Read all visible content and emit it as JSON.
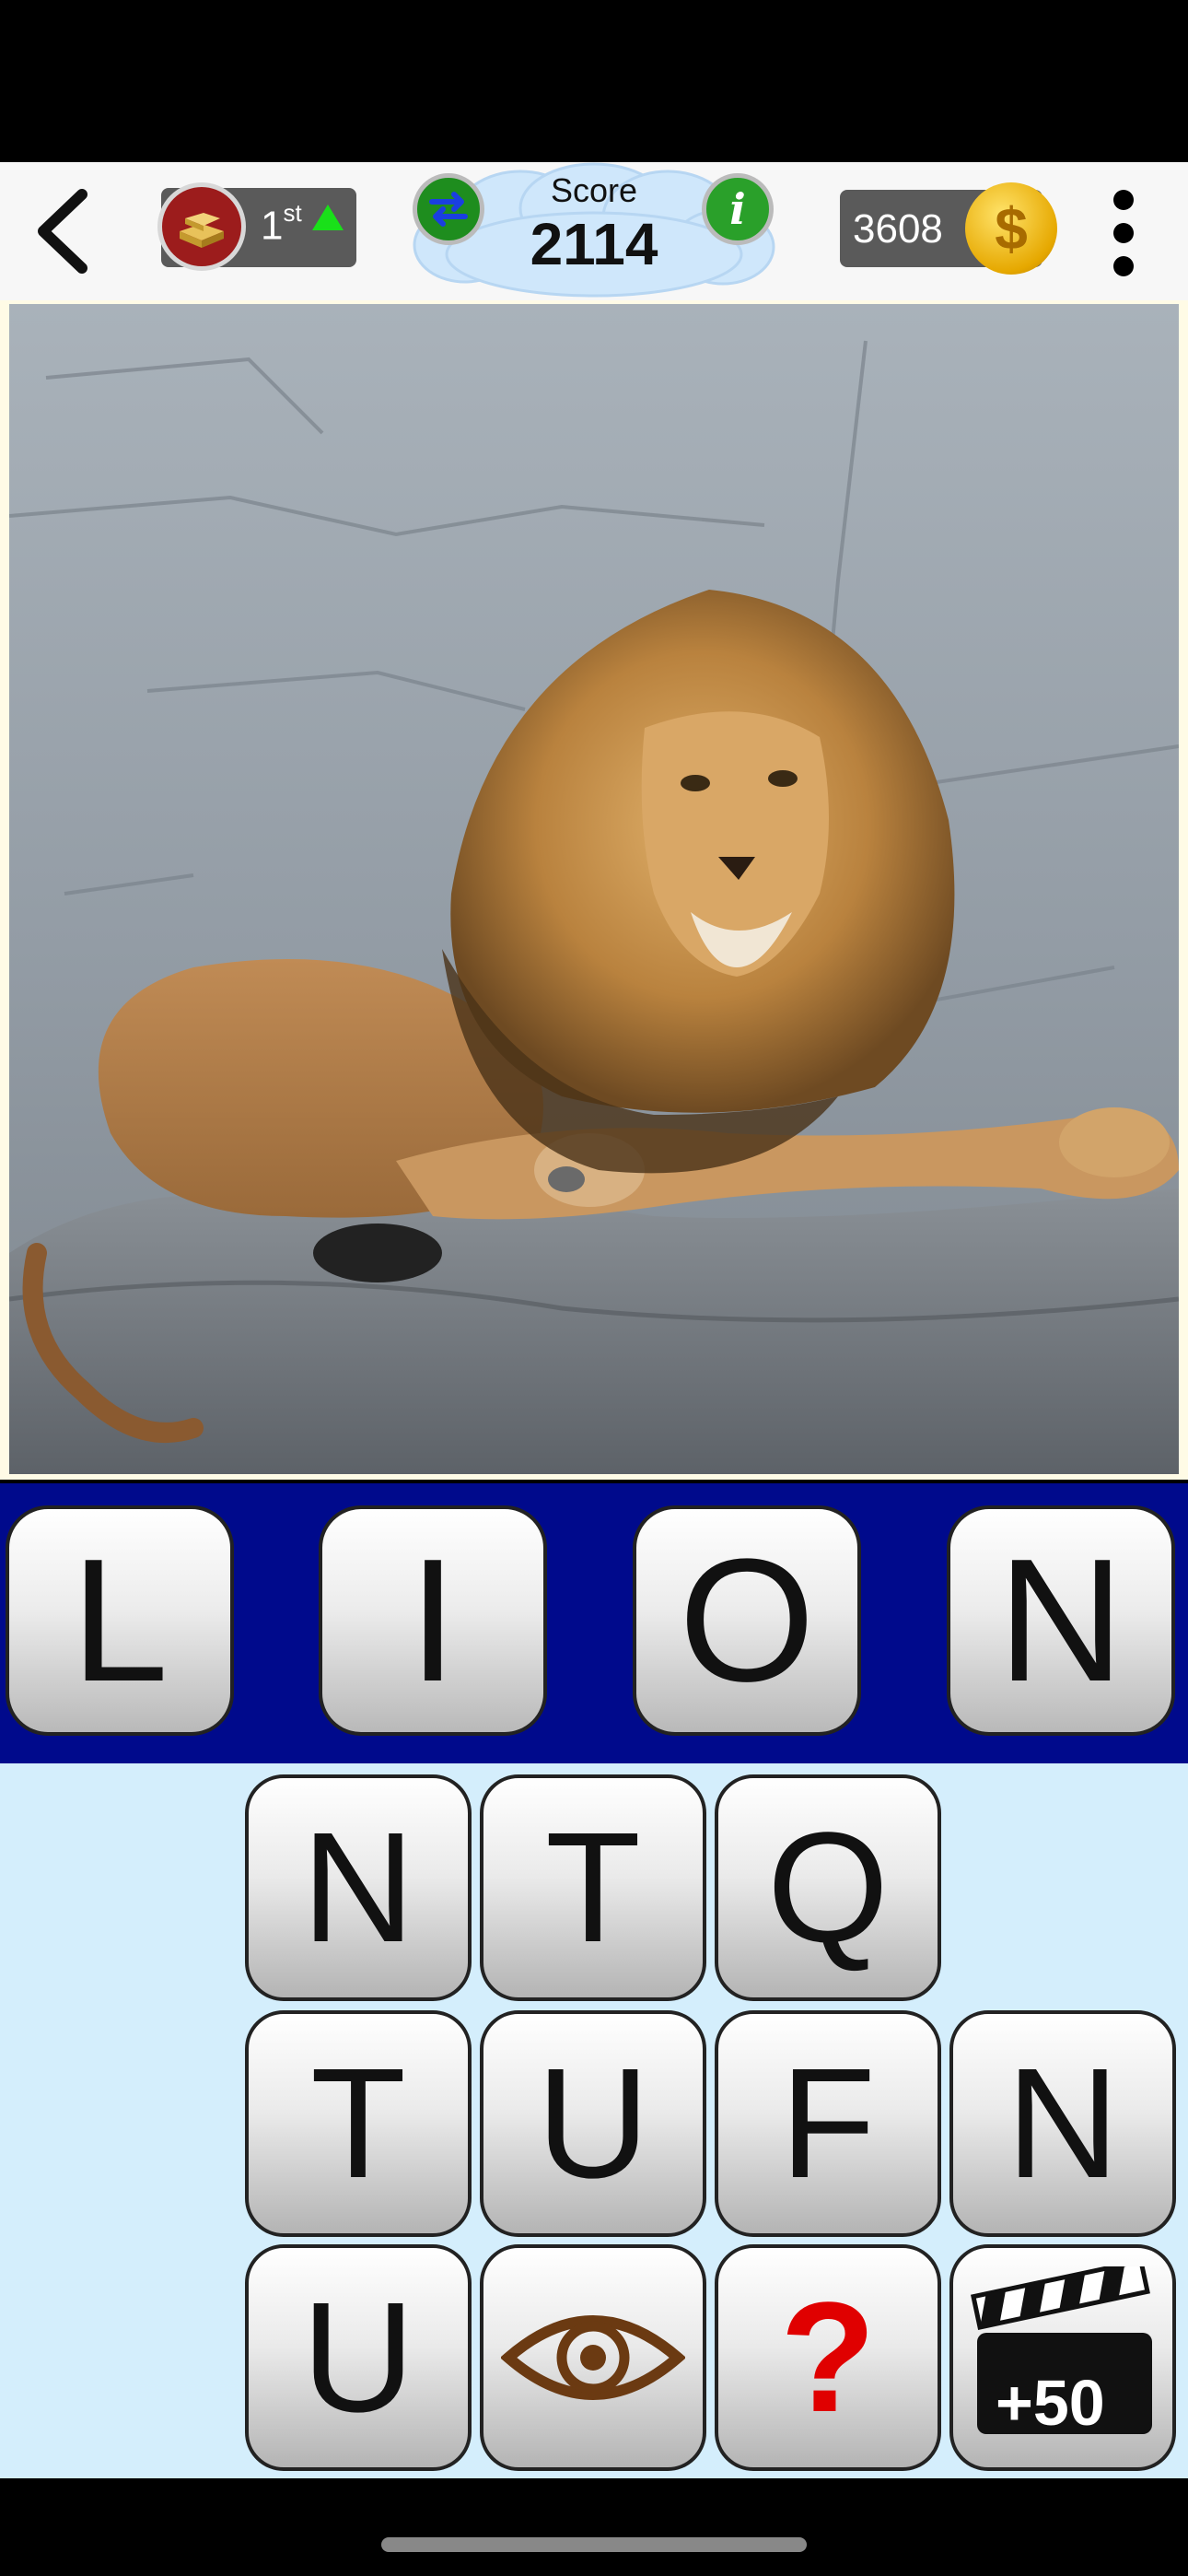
{
  "header": {
    "rank_number": "1",
    "rank_suffix": "st",
    "score_label": "Score",
    "score_value": "2114",
    "info_glyph": "i",
    "coins": "3608",
    "coin_glyph": "$"
  },
  "icons": {
    "back": "chevron-left-icon",
    "rank_badge": "gold-bars-icon",
    "rank_trend": "up-arrow-icon",
    "swap": "swap-arrows-icon",
    "info": "info-icon",
    "coin": "dollar-coin-icon",
    "menu": "vertical-dots-icon",
    "reveal": "eye-icon",
    "hint": "question-mark-icon",
    "video": "clapperboard-icon"
  },
  "puzzle_image": "photo of a male lion lying on a rock",
  "answer": {
    "letters": [
      "L",
      "I",
      "O",
      "N"
    ]
  },
  "keyboard": {
    "row1": [
      "N",
      "T",
      "Q"
    ],
    "row2": [
      "T",
      "U",
      "F",
      "N"
    ],
    "row3_letter": "U",
    "hint_glyph": "?",
    "video_reward": "+50"
  },
  "colors": {
    "answer_bar": "#000a8c",
    "keyboard_bg": "#d4eefc",
    "hint_red": "#e00000",
    "eye_brown": "#6b3a12",
    "rank_arrow": "#19e019"
  }
}
